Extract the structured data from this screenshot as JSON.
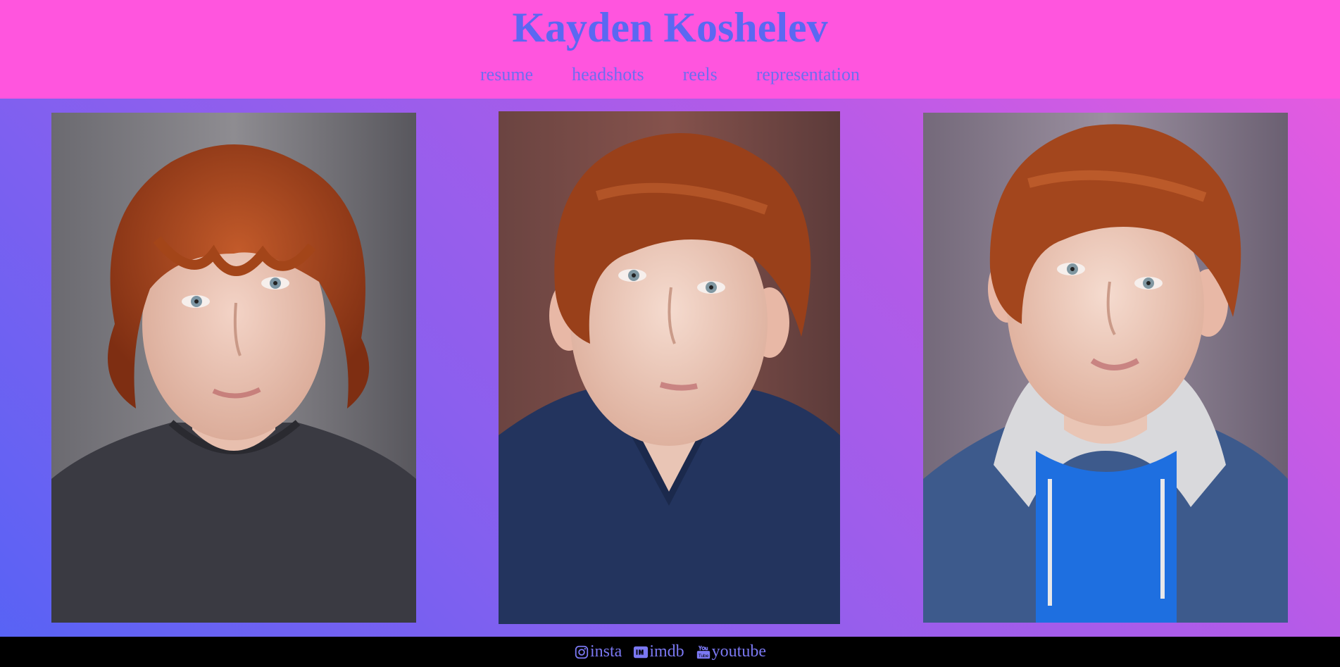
{
  "header": {
    "title": "Kayden Koshelev",
    "background": "#ff55de",
    "title_color": "#5b68f2"
  },
  "nav": {
    "items": [
      {
        "label": "resume"
      },
      {
        "label": "headshots"
      },
      {
        "label": "reels"
      },
      {
        "label": "representation"
      }
    ],
    "link_color": "#6f6cf0"
  },
  "gallery": {
    "photos": [
      {
        "alt": "headshot-dark-tshirt-curly-hair",
        "icon": "photo"
      },
      {
        "alt": "headshot-navy-vneck",
        "icon": "photo"
      },
      {
        "alt": "headshot-denim-jacket-hoodie",
        "icon": "photo"
      }
    ]
  },
  "footer": {
    "links": [
      {
        "label": "insta",
        "icon": "instagram-icon"
      },
      {
        "label": "imdb",
        "icon": "imdb-icon"
      },
      {
        "label": "youtube",
        "icon": "youtube-icon"
      }
    ],
    "background": "#000000",
    "link_color": "#7b78f2"
  }
}
